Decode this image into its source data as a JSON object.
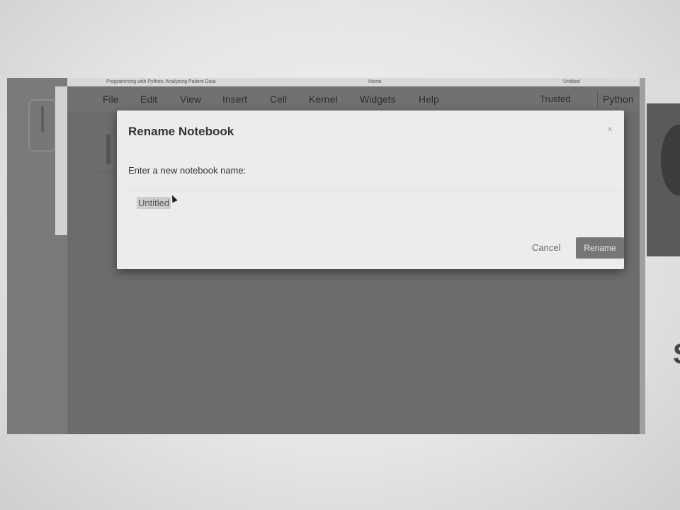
{
  "browser": {
    "tab_left": "Programming with Python: Analyzing Patient Data",
    "tab_center": "Home",
    "tab_right": "Untitled"
  },
  "menubar": {
    "items": [
      "File",
      "Edit",
      "View",
      "Insert",
      "Cell",
      "Kernel",
      "Widgets",
      "Help"
    ],
    "trusted_label": "Trusted",
    "kernel_label": "Python"
  },
  "modal": {
    "title": "Rename Notebook",
    "close_glyph": "×",
    "prompt": "Enter a new notebook name:",
    "input_value": "Untitled",
    "cancel_label": "Cancel",
    "rename_label": "Rename"
  },
  "side": {
    "glyph": "S"
  },
  "colors": {
    "overlay": "#6c6c6c",
    "modal_bg": "#ececec",
    "primary_button": "#767676"
  }
}
